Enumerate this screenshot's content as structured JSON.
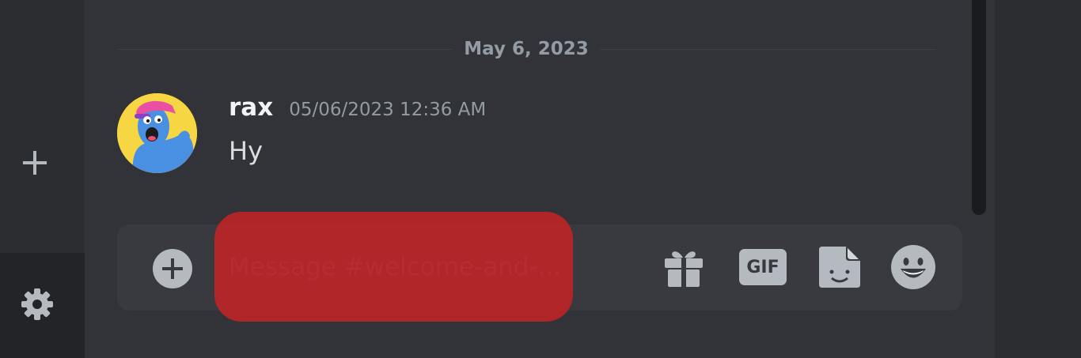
{
  "date_divider": "May 6, 2023",
  "message": {
    "author": "rax",
    "timestamp": "05/06/2023 12:36 AM",
    "content": "Hy"
  },
  "composer": {
    "placeholder": "Message #welcome-and-...",
    "gif_label": "GIF"
  },
  "icons": {
    "rail_add": "plus-icon",
    "rail_settings": "gear-icon",
    "composer_add": "plus-circle-icon",
    "gift": "gift-icon",
    "gif": "gif-icon",
    "sticker": "sticker-icon",
    "emoji": "emoji-icon"
  },
  "colors": {
    "background": "#313338",
    "sidebar": "#2b2d31",
    "composer": "#383a40",
    "redaction": "#c02326",
    "avatar_background": "#f6d743",
    "avatar_character": "#4a90e2"
  }
}
